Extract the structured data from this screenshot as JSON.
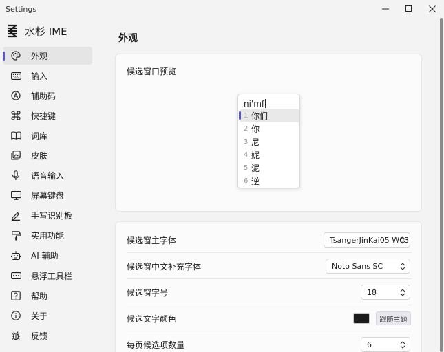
{
  "window": {
    "title": "Settings",
    "minimize_glyph": "—",
    "maximize_glyph": "☐",
    "close_glyph": "✕"
  },
  "brand": {
    "name": "水杉 IME",
    "logo_icon": "mizusugi-logo-icon"
  },
  "sidebar": {
    "active_index": 0,
    "accent_color": "#5b57c9",
    "items": [
      {
        "label": "外观",
        "icon": "palette-icon"
      },
      {
        "label": "输入",
        "icon": "keyboard-icon"
      },
      {
        "label": "辅助码",
        "icon": "compass-a-icon"
      },
      {
        "label": "快捷键",
        "icon": "command-icon"
      },
      {
        "label": "词库",
        "icon": "book-icon"
      },
      {
        "label": "皮肤",
        "icon": "image-stack-icon"
      },
      {
        "label": "语音输入",
        "icon": "microphone-icon"
      },
      {
        "label": "屏幕键盘",
        "icon": "monitor-icon"
      },
      {
        "label": "手写识别板",
        "icon": "pen-icon"
      },
      {
        "label": "实用功能",
        "icon": "paint-roller-icon"
      },
      {
        "label": "AI 辅助",
        "icon": "robot-icon"
      },
      {
        "label": "悬浮工具栏",
        "icon": "toolbar-dots-icon"
      },
      {
        "label": "帮助",
        "icon": "help-icon"
      },
      {
        "label": "关于",
        "icon": "info-icon"
      },
      {
        "label": "反馈",
        "icon": "bug-icon"
      }
    ]
  },
  "main": {
    "page_title": "外观",
    "preview": {
      "title": "候选窗口预览",
      "preedit": "ni'mf",
      "candidates": [
        {
          "num": "1",
          "text": "你们"
        },
        {
          "num": "2",
          "text": "你"
        },
        {
          "num": "3",
          "text": "尼"
        },
        {
          "num": "4",
          "text": "妮"
        },
        {
          "num": "5",
          "text": "泥"
        },
        {
          "num": "6",
          "text": "逆"
        }
      ],
      "highlight_index": 0
    },
    "settings": {
      "main_font": {
        "label": "候选窗主字体",
        "value": "TsangerJinKai05 W03"
      },
      "cjk_fallback_font": {
        "label": "候选窗中文补充字体",
        "value": "Noto Sans SC"
      },
      "font_size": {
        "label": "候选窗字号",
        "value": "18"
      },
      "text_color": {
        "label": "候选文字颜色",
        "color": "#1b1b1b",
        "follow_theme_label": "跟随主题"
      },
      "page_size": {
        "label": "每页候选项数量",
        "value": "6"
      }
    }
  }
}
